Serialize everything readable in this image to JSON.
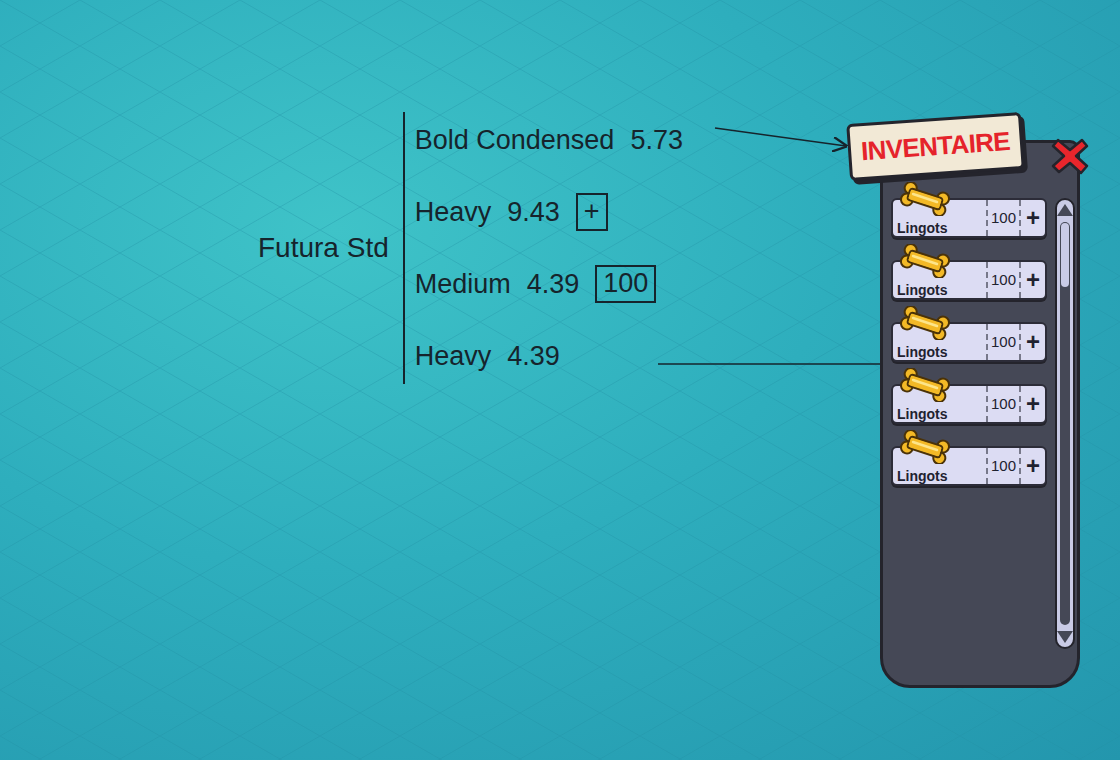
{
  "annotations": {
    "font_family": "Futura Std",
    "specs": [
      {
        "weight": "Bold Condensed",
        "size": "5.73",
        "sample": null
      },
      {
        "weight": "Heavy",
        "size": "9.43",
        "sample": "+"
      },
      {
        "weight": "Medium",
        "size": "4.39",
        "sample": "100"
      },
      {
        "weight": "Heavy",
        "size": "4.39",
        "sample": null
      }
    ]
  },
  "inventory": {
    "title": "INVENTAIRE",
    "items": [
      {
        "label": "Lingots",
        "count": "100",
        "add": "+"
      },
      {
        "label": "Lingots",
        "count": "100",
        "add": "+"
      },
      {
        "label": "Lingots",
        "count": "100",
        "add": "+"
      },
      {
        "label": "Lingots",
        "count": "100",
        "add": "+"
      },
      {
        "label": "Lingots",
        "count": "100",
        "add": "+"
      }
    ]
  }
}
